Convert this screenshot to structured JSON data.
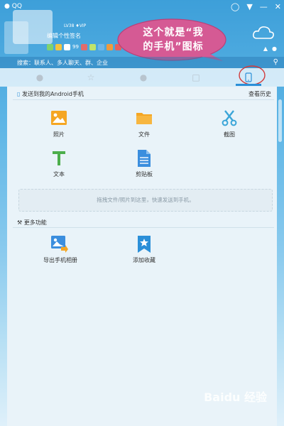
{
  "titlebar": {
    "app_name": "QQ"
  },
  "profile": {
    "signature": "编辑个性签名",
    "vip_badge": "LV38 ♦VIP",
    "status_count": "99"
  },
  "callout": {
    "line1": "这个就是“我",
    "line2": "的手机”图标"
  },
  "search": {
    "placeholder": "搜索：联系人、多人聊天、群、企业"
  },
  "tabs": [
    {
      "name": "contacts"
    },
    {
      "name": "favorites"
    },
    {
      "name": "groups"
    },
    {
      "name": "chat"
    },
    {
      "name": "my-phone"
    }
  ],
  "send_section": {
    "title": "发送到我的Android手机",
    "history_link": "查看历史"
  },
  "tiles": [
    {
      "label": "照片",
      "icon": "photo-icon"
    },
    {
      "label": "文件",
      "icon": "folder-icon"
    },
    {
      "label": "截图",
      "icon": "scissors-icon"
    },
    {
      "label": "文本",
      "icon": "text-icon"
    },
    {
      "label": "剪贴板",
      "icon": "clipboard-icon"
    }
  ],
  "dropzone": {
    "text": "拖拽文件/照片到这里，快速发送到手机。"
  },
  "more_section": {
    "title": "更多功能"
  },
  "more_tiles": [
    {
      "label": "导出手机相册",
      "icon": "export-album-icon"
    },
    {
      "label": "添加收藏",
      "icon": "bookmark-icon"
    }
  ],
  "watermark": "Baidu 经验",
  "colors": {
    "accent": "#2b8fd8",
    "callout": "#d55a94",
    "orange": "#f5a623"
  }
}
